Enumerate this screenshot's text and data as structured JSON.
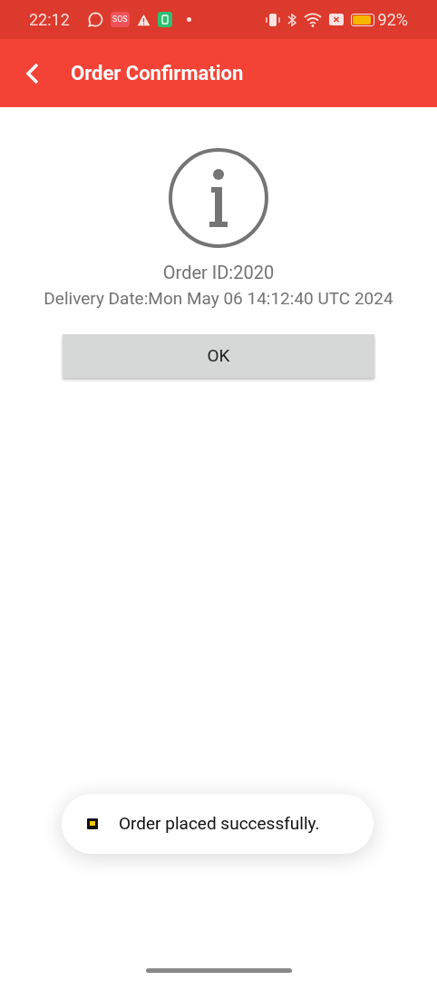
{
  "status_bar": {
    "time": "22:12",
    "sos_badge": "SOS",
    "battery_text": "92%"
  },
  "toolbar": {
    "title": "Order Confirmation"
  },
  "order": {
    "id_line": "Order ID:2020",
    "delivery_line": "Delivery Date:Mon May 06 14:12:40 UTC 2024"
  },
  "buttons": [
    "OK"
  ],
  "toast": {
    "message": "Order placed successfully."
  }
}
